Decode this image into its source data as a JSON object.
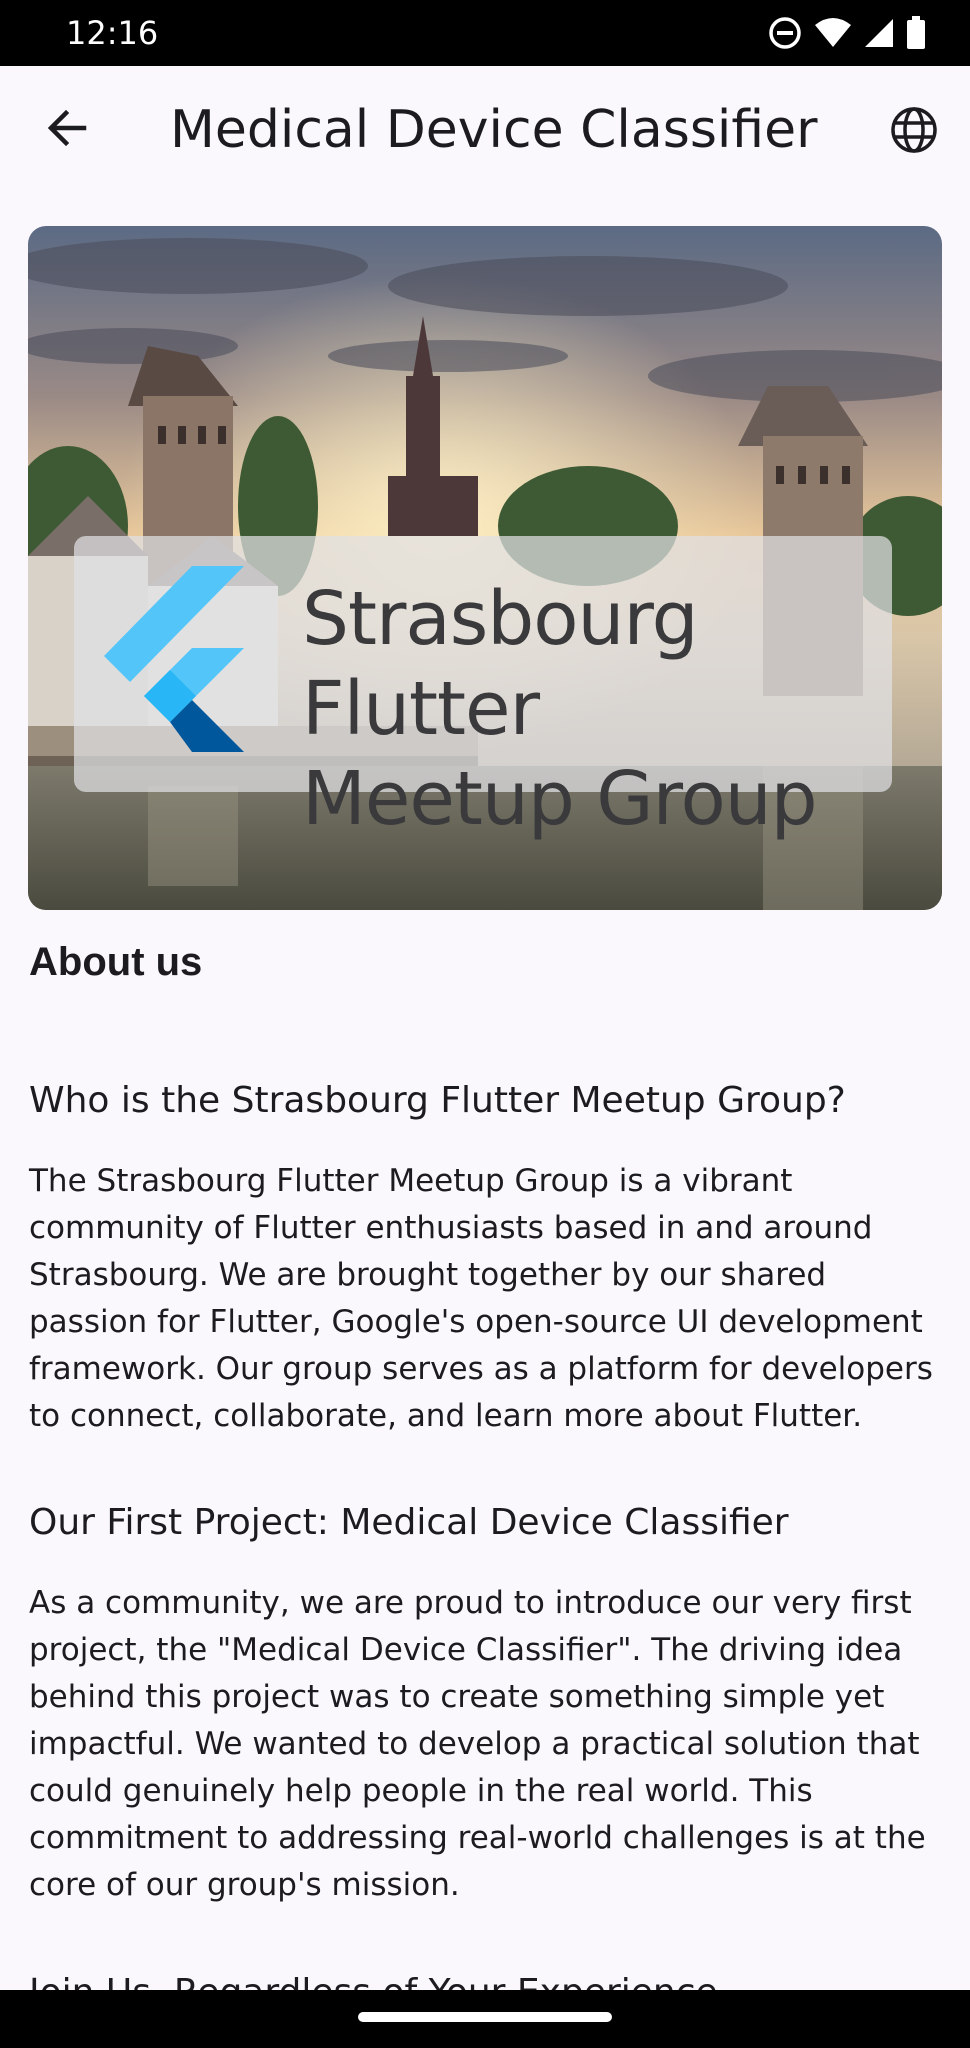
{
  "status_bar": {
    "time": "12:16",
    "icons": [
      "do-not-disturb-icon",
      "wifi-icon",
      "signal-icon",
      "battery-icon"
    ]
  },
  "app_bar": {
    "title": "Medical Device Classifier",
    "back_icon": "arrow-back-icon",
    "language_icon": "globe-icon"
  },
  "hero": {
    "banner_line1": "Strasbourg Flutter",
    "banner_line2": "Meetup Group"
  },
  "content": {
    "about_heading": "About us",
    "section1_title": "Who is the Strasbourg Flutter Meetup Group?",
    "section1_text": "The Strasbourg Flutter Meetup Group is a vibrant community of Flutter enthusiasts based in and around Strasbourg. We are brought together by our shared passion for Flutter, Google's open-source UI development framework. Our group serves as a platform for developers to connect, collaborate, and learn more about Flutter.",
    "section2_title": "Our First Project: Medical Device Classifier",
    "section2_text": "As a community, we are proud to introduce our very first project, the \"Medical Device Classifier\". The driving idea behind this project was to create something simple yet impactful. We wanted to develop a practical solution that could genuinely help people in the real world. This commitment to addressing real-world challenges is at the core of our group's mission.",
    "section3_title": "Join Us, Regardless of Your Experience"
  },
  "colors": {
    "background": "#fbf8fd",
    "text": "#1c1b1f",
    "flutter_light_blue": "#54c5f8",
    "flutter_dark_blue": "#01579b"
  }
}
